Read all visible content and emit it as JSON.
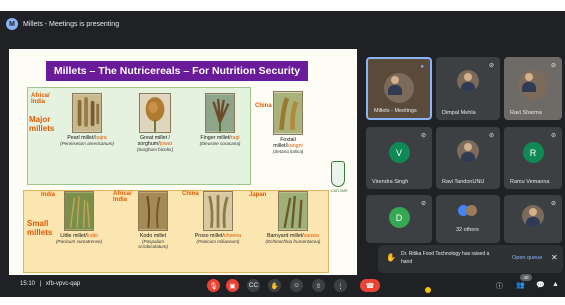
{
  "presenting": {
    "badge": "M",
    "text": "Millets - Meetings is presenting"
  },
  "slide": {
    "title": "Millets – The Nutricereals – For Nutrition Security",
    "major": {
      "origin": "Africa/ India",
      "heading": "Major millets",
      "crops": [
        {
          "name": "Pearl millet/",
          "local": "bajra",
          "sci": "(Pennisetum americanum)"
        },
        {
          "name": "Great millet / sorghum/",
          "local": "jowar",
          "sci": "(Sorghum bicolor)"
        },
        {
          "name": "Finger millet/",
          "local": "ragi",
          "sci": "(Eleusine coracana)"
        },
        {
          "origin": "China",
          "name": "Foxtail millet/",
          "local": "kangni",
          "sci": "(Setaria italica)"
        }
      ]
    },
    "small": {
      "heading": "Small millets",
      "crops": [
        {
          "origin": "India",
          "name": "Little millet/",
          "local": "kutki",
          "sci": "(Panicum sumatrense)"
        },
        {
          "origin": "Africa/ India",
          "name": "Kodo millet",
          "local": "",
          "sci": "(Paspalum scrobiculatum)"
        },
        {
          "origin": "China",
          "name": "Proso millet/",
          "local": "cheena",
          "sci": "(Panicum miliaceum)"
        },
        {
          "origin": "Japan",
          "name": "Barnyard millet/",
          "local": "sanwa",
          "sci": "(Echinochloa frumentacea)"
        }
      ]
    },
    "emblem_text": "ICAR-IIMR"
  },
  "participants": [
    {
      "name": "Millets - Meetings",
      "type": "photo",
      "mic": "speaking"
    },
    {
      "name": "Dimpal Mehla",
      "type": "photo",
      "mic": "muted"
    },
    {
      "name": "Ravi Sharma",
      "type": "photo",
      "mic": "muted"
    },
    {
      "name": "Virendra Singh",
      "initial": "V",
      "color": "#0f8a55",
      "mic": "muted"
    },
    {
      "name": "Ravi TandonUNU",
      "type": "photo",
      "mic": "muted"
    },
    {
      "name": "Ramu Vemanna",
      "initial": "R",
      "color": "#0f8a55",
      "mic": "muted"
    },
    {
      "name": "",
      "initial": "D",
      "color": "#34a853",
      "mic": "muted"
    },
    {
      "name": "32 others",
      "type": "others",
      "mic": ""
    },
    {
      "name": "",
      "type": "photo",
      "mic": "muted"
    }
  ],
  "notification": {
    "hand_icon": "raised-hand-icon",
    "message": "Dr. Ritika Food Technology has raised a hand",
    "action": "Open queue",
    "close": "✕"
  },
  "bottom_bar": {
    "time": "15:10",
    "separator": "|",
    "meeting_code": "xfb-vpvc-qap",
    "participant_count": "40"
  },
  "colors": {
    "meet_bg": "#202124",
    "tile_bg": "#3c4043",
    "slide_title_bg": "#6a1b9a",
    "accent_red": "#ea4335",
    "link_blue": "#8ab4f8"
  }
}
